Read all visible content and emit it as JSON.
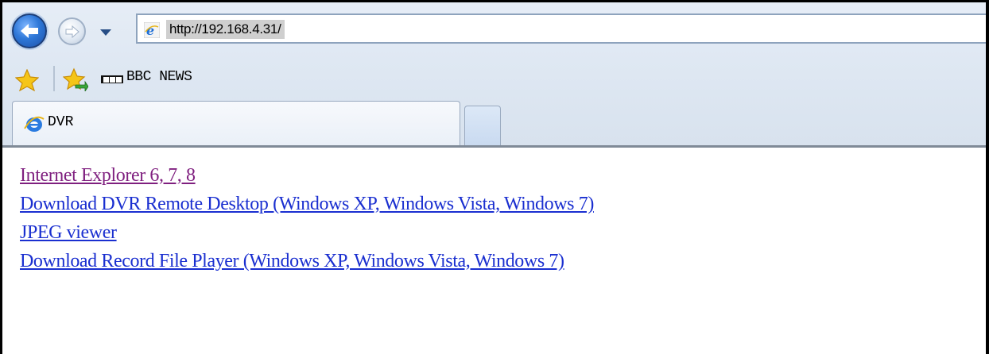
{
  "browser": {
    "address": "http://192.168.4.31/",
    "favorites": [
      {
        "label": "BBC NEWS",
        "icon": "bbc-icon"
      }
    ],
    "tabs": [
      {
        "label": "DVR",
        "icon": "ie-icon",
        "active": true
      }
    ]
  },
  "page": {
    "links": [
      {
        "label": "Internet Explorer 6, 7, 8",
        "state": "visited"
      },
      {
        "label": "Download DVR Remote Desktop (Windows XP, Windows Vista, Windows 7)",
        "state": "link"
      },
      {
        "label": "JPEG viewer",
        "state": "link"
      },
      {
        "label": "Download Record File Player (Windows XP, Windows Vista, Windows 7)",
        "state": "link"
      }
    ]
  },
  "colors": {
    "visited_link": "#7f1f7f",
    "link": "#1a2fd0"
  }
}
